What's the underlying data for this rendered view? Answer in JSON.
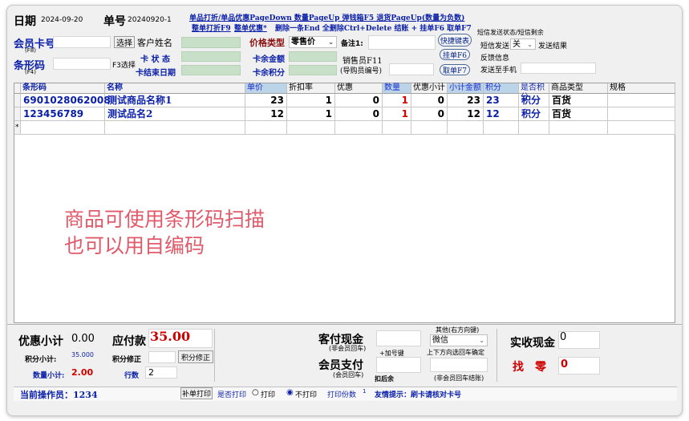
{
  "header": {
    "date_label": "日期",
    "date_value": "2024-09-20",
    "order_label": "单号",
    "order_value": "20240920-1",
    "shortcuts_line1": "单品打折/单品优惠PageDown 数量PageUp 弹钱箱F5 退货PageUp(数量为负数)",
    "shortcuts_line2a": "整单打折F9",
    "shortcuts_line2b": "整单优惠*",
    "shortcuts_line2c": "删除一条End 全删除Ctrl+Delete 结账 + 挂单F6 取单F7"
  },
  "member": {
    "card_label": "会员卡号",
    "card_hint": "(F8)",
    "card_value": "",
    "select_btn": "选择",
    "name_label": "客户姓名",
    "barcode_label": "条形码",
    "barcode_hint": "(F4)",
    "barcode_value": "",
    "f3_select": "F3选择",
    "status_label": "卡 状 态",
    "expire_label": "卡结束日期",
    "price_type_label": "价格类型",
    "price_type_value": "零售价",
    "balance_label": "卡余金额",
    "points_label": "卡余积分",
    "note_label": "备注1:",
    "salesman_label": "销售员F11",
    "guide_label": "(导购员编号)"
  },
  "buttons": {
    "shortcut_keys": "快捷键表",
    "hang": "挂单F6",
    "take": "取单F7"
  },
  "sms": {
    "title": "短信发送状态/短信剩余",
    "send_label": "短信发送",
    "send_value": "关",
    "result_label": "发送结果",
    "feedback_label": "反馈信息",
    "phone_label": "发送至手机"
  },
  "table": {
    "columns": [
      "条形码",
      "名称",
      "单价",
      "折扣率",
      "优惠",
      "数量",
      "优惠小计",
      "小计金额",
      "积分",
      "是否积分",
      "商品类型",
      "规格"
    ],
    "rows": [
      {
        "barcode": "6901028062008",
        "name": "测试商品名称1",
        "price": "23",
        "discount": "1",
        "promo": "0",
        "qty": "1",
        "promo_sub": "0",
        "subtotal": "23",
        "points": "23",
        "is_points": "积分",
        "type": "百货",
        "spec": ""
      },
      {
        "barcode": "123456789",
        "name": "测试品名2",
        "price": "12",
        "discount": "1",
        "promo": "0",
        "qty": "1",
        "promo_sub": "0",
        "subtotal": "12",
        "points": "12",
        "is_points": "积分",
        "type": "百货",
        "spec": ""
      }
    ],
    "new_row_marker": "*"
  },
  "overlay": {
    "line1": "商品可使用条形码扫描",
    "line2": "也可以用自编码"
  },
  "footer": {
    "promo_subtotal_label": "优惠小计",
    "promo_subtotal_value": "0.00",
    "payable_label": "应付款",
    "payable_value": "35.00",
    "points_subtotal_label": "积分小计:",
    "points_subtotal_value": "35.000",
    "points_adjust_label": "积分修正",
    "points_adjust_btn": "积分修正",
    "qty_subtotal_label": "数量小计:",
    "qty_subtotal_value": "2.00",
    "rows_label": "行数",
    "rows_value": "2",
    "cash_label": "客付现金",
    "cash_hint": "(非会员回车)",
    "add_key": "+加号键",
    "member_pay_label": "会员支付",
    "member_pay_hint": "(会员回车)",
    "deduct_label": "扣后余",
    "other_label": "其他(右方向键)",
    "other_value": "微信",
    "arrow_hint": "上下方向选回车确定",
    "other_hint": "(非会员回车结账)",
    "actual_cash_label": "实收现金",
    "actual_cash_value": "0",
    "change_label": "找　零",
    "change_value": "0"
  },
  "status": {
    "operator": "当前操作员：1234",
    "reprint": "补单打印",
    "print_q": "是否打印",
    "print_opt": "打印",
    "noprint_opt": "不打印",
    "copies_label": "打印份数",
    "copies_value": "1",
    "tip": "友情提示：刷卡请核对卡号"
  }
}
